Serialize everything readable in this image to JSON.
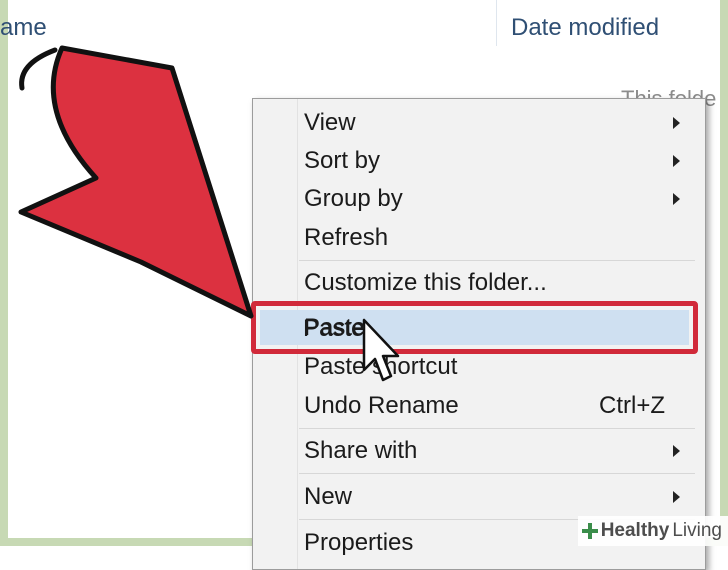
{
  "explorer": {
    "columns": {
      "name_label": "ame",
      "date_modified_label": "Date modified"
    },
    "empty_message": "This folde"
  },
  "context_menu": {
    "items": [
      {
        "label": "View",
        "has_submenu": true
      },
      {
        "label": "Sort by",
        "has_submenu": true
      },
      {
        "label": "Group by",
        "has_submenu": true
      },
      {
        "label": "Refresh",
        "has_submenu": false
      },
      {
        "label": "Customize this folder...",
        "has_submenu": false
      },
      {
        "label": "Paste",
        "has_submenu": false,
        "highlighted": true
      },
      {
        "label": "Paste shortcut",
        "has_submenu": false
      },
      {
        "label": "Undo Rename",
        "shortcut": "Ctrl+Z"
      },
      {
        "label": "Share with",
        "has_submenu": true
      },
      {
        "label": "New",
        "has_submenu": true
      },
      {
        "label": "Properties",
        "has_submenu": false
      }
    ]
  },
  "overlay": {
    "highlight_color": "#d12a3a",
    "arrow_color": "#dc3140",
    "selected_item_color": "#cfe0f1"
  },
  "watermark": {
    "brand_bold": "Healthy",
    "brand_rest": "Living"
  }
}
